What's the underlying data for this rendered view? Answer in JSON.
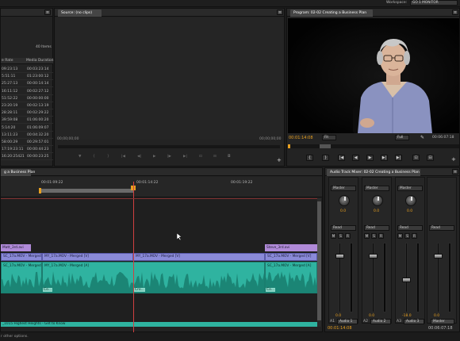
{
  "workspace": {
    "label": "Workspace:",
    "value": "GO 1 MONITOR"
  },
  "project": {
    "item_count": "40 Items",
    "col_rate": "e Rate",
    "col_duration": "Media Duration",
    "rows": [
      {
        "rate": "",
        "dur": "00:03:23:14"
      },
      {
        "rate": "",
        "dur": "01:23:00:12"
      },
      {
        "rate": "",
        "dur": "00:00:14:14"
      },
      {
        "rate": "",
        "dur": "00:02:27:12"
      },
      {
        "rate": "",
        "dur": "00:00:00:00"
      },
      {
        "rate": "",
        "dur": "00:02:13:19"
      },
      {
        "rate": "",
        "dur": "00:02:29:22"
      },
      {
        "rate": "",
        "dur": "01:06:00:20"
      },
      {
        "rate": "",
        "dur": "01:06:09:07"
      },
      {
        "rate": "",
        "dur": "00:04:32:20"
      },
      {
        "rate": "",
        "dur": "00:29:57:01"
      },
      {
        "rate": "",
        "dur": "00:00:44:23"
      },
      {
        "rate": "",
        "dur": "00:00:23:25"
      }
    ],
    "rates": [
      "09:23:13",
      "5:51:11",
      "25:27:13",
      "16:11:12",
      "51:52:22",
      "23:20:19",
      "28:28:11",
      "39:59:08",
      "5:14:20",
      "13:11:23",
      "58:00:29",
      "17:19:23:11",
      "16:20:25421"
    ]
  },
  "source": {
    "tab_label": "Source: (no clips)",
    "timecode_left": "00;00;00;00",
    "timecode_right": "00;00;00;00"
  },
  "program": {
    "tab_label": "Program: 02-02 Creating a Business Plan",
    "timecode_current": "00:01:14:08",
    "timecode_total": "00:06:07:18",
    "fit_label": "Fit",
    "quality_label": "Full"
  },
  "timeline": {
    "tab_label": "g a Business Plan",
    "ruler_ticks": [
      "00:01:09:22",
      "00:01:14:22",
      "00:01:19:22"
    ],
    "video_top": [
      {
        "label": "Matt_3rd.avi"
      },
      {
        "label": "Steve_3rd.avi"
      }
    ],
    "video_clips": [
      {
        "label": "SC_17a.MOV - Merged [V]"
      },
      {
        "label": "MY_17a.MOV - Merged [V]"
      },
      {
        "label": "MY_17a.MOV - Merged [V]"
      },
      {
        "label": "SC_17a.MOV - Merged [V]"
      }
    ],
    "audio_clips": [
      {
        "label": "SC_17a.MOV - Merged [A]"
      },
      {
        "label": "MY_17a.MOV - Merged [A]"
      },
      {
        "label": "SC_17a.MOV - Merged [A]"
      }
    ],
    "crossfades": [
      "Co...",
      "Cro...",
      "Co..."
    ],
    "music_label": "_1015 Highest Heights - Get to Know",
    "status_text": "r other options."
  },
  "mixer": {
    "tab_label": "Audio Track Mixer: 02-02 Creating a Business Plan",
    "tracks": [
      {
        "read": "Read",
        "route": "Master",
        "pan": "0.0",
        "volume": "0.0",
        "name": "Audio 1",
        "id": "A1"
      },
      {
        "read": "Read",
        "route": "Master",
        "pan": "0.0",
        "volume": "0.0",
        "name": "Audio 2",
        "id": "A2"
      },
      {
        "read": "Read",
        "route": "Master",
        "pan": "0.0",
        "volume": "-18.0",
        "name": "Audio 3",
        "id": "A3"
      },
      {
        "read": "Read",
        "route": "",
        "pan": "",
        "volume": "0.0",
        "name": "Master",
        "id": ""
      }
    ],
    "ms_label": "M",
    "s_label": "S",
    "r_label": "R",
    "timecode_current": "00:01:14:08",
    "timecode_total": "00:06:07:18"
  },
  "colors": {
    "accent": "#e8a020",
    "video_clip": "#8a8ad8",
    "audio_clip": "#2fb3a0",
    "playhead": "#d04040"
  }
}
